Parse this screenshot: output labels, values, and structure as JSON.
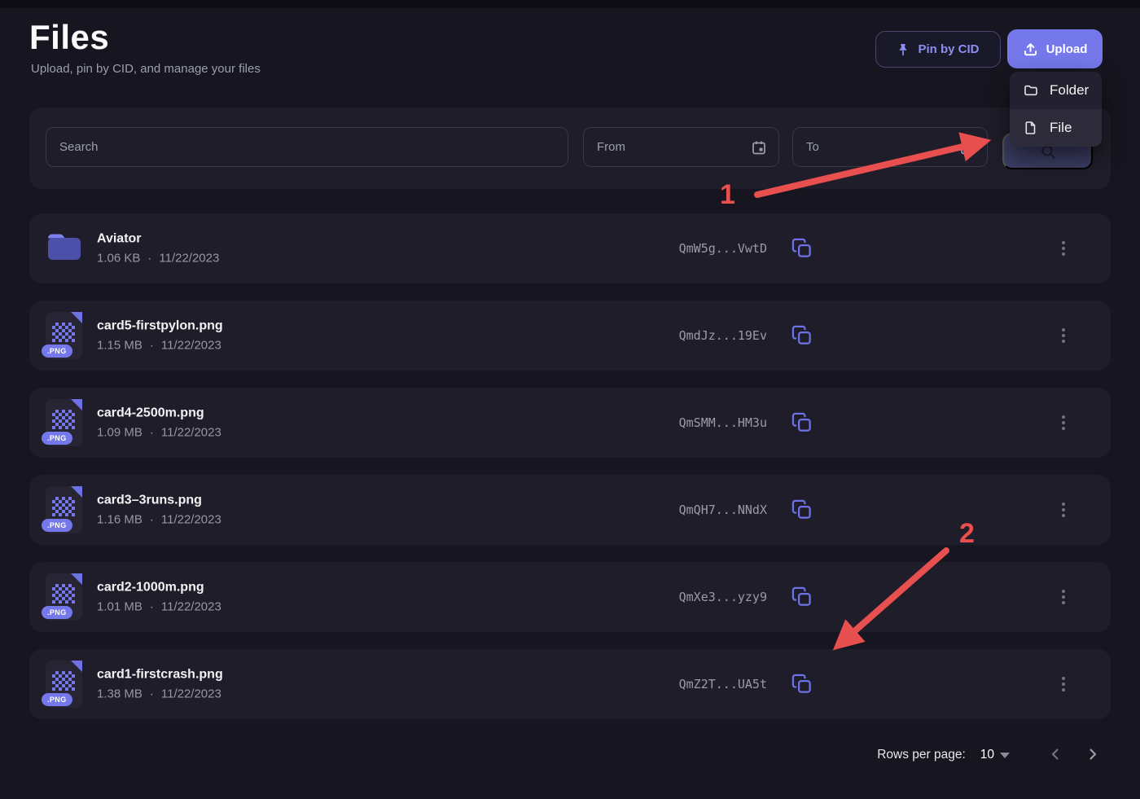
{
  "page": {
    "title": "Files",
    "subtitle": "Upload, pin by CID, and manage your files"
  },
  "header": {
    "pin_by_cid_label": "Pin by CID",
    "upload_label": "Upload"
  },
  "upload_menu": {
    "items": [
      {
        "label": "Folder",
        "icon": "folder-icon"
      },
      {
        "label": "File",
        "icon": "file-icon"
      }
    ],
    "highlighted_item": "File"
  },
  "filters": {
    "search_placeholder": "Search",
    "from_placeholder": "From",
    "to_placeholder": "To"
  },
  "list": {
    "meta_separator": "·"
  },
  "files": [
    {
      "name": "Aviator",
      "size": "1.06 KB",
      "date": "11/22/2023",
      "cid": "QmW5g...VwtD",
      "type": "folder",
      "badge": ""
    },
    {
      "name": "card5-firstpylon.png",
      "size": "1.15 MB",
      "date": "11/22/2023",
      "cid": "QmdJz...19Ev",
      "type": "png",
      "badge": ".PNG"
    },
    {
      "name": "card4-2500m.png",
      "size": "1.09 MB",
      "date": "11/22/2023",
      "cid": "QmSMM...HM3u",
      "type": "png",
      "badge": ".PNG"
    },
    {
      "name": "card3–3runs.png",
      "size": "1.16 MB",
      "date": "11/22/2023",
      "cid": "QmQH7...NNdX",
      "type": "png",
      "badge": ".PNG"
    },
    {
      "name": "card2-1000m.png",
      "size": "1.01 MB",
      "date": "11/22/2023",
      "cid": "QmXe3...yzy9",
      "type": "png",
      "badge": ".PNG"
    },
    {
      "name": "card1-firstcrash.png",
      "size": "1.38 MB",
      "date": "11/22/2023",
      "cid": "QmZ2T...UA5t",
      "type": "png",
      "badge": ".PNG"
    }
  ],
  "pagination": {
    "rows_per_page_label": "Rows per page:",
    "rows_per_page_value": "10"
  },
  "annotations": [
    {
      "label": "1",
      "target": "upload-menu-item-file"
    },
    {
      "label": "2",
      "target": "copy-cid-button-last-row"
    }
  ],
  "colors": {
    "page_bg": "#17151f",
    "panel_bg": "#1f1d29",
    "dropdown_bg": "#232130",
    "accent": "#7478ea",
    "accent_text": "#8b8ef2",
    "annotation_red": "#e8504f",
    "muted_text": "#9aa0ab"
  }
}
